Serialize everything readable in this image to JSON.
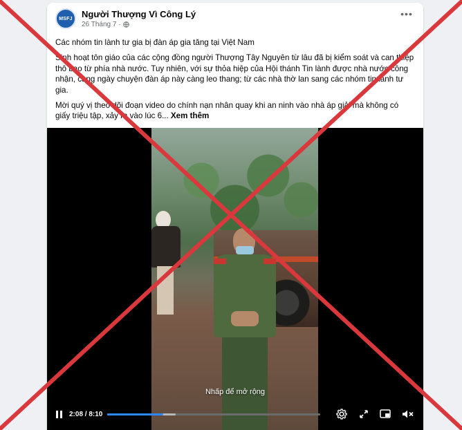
{
  "post": {
    "author": "Người Thượng Vì Công Lý",
    "avatar_text": "MSFJ",
    "date": "26 Tháng 7",
    "separator": "·",
    "title_line": "Các nhóm tin lành tư gia bị đàn áp gia tăng tại Việt Nam",
    "paragraph1": "Sinh hoạt tôn giáo của các cộng đồng người Thượng Tây Nguyên từ lâu đã bị kiểm soát và can thiệp thô bạo từ phía nhà nước. Tuy nhiên, với sự thỏa hiệp của Hội thánh Tin lành được nhà nước công nhận, càng ngày chuyện đàn áp này càng leo thang; từ các nhà thờ lan sang các nhóm tin lành tư gia.",
    "paragraph2": "Mời quý vị theo dõi đoạn video do chính nạn nhân quay  khi an ninh vào nhà áp giải mà không có giấy triệu tập, xảy ra vào lúc 6...",
    "see_more": "Xem thêm"
  },
  "video": {
    "expand_hint": "Nhấp để mở rộng",
    "time": "2:08 / 8:10",
    "progress": 0.262,
    "buffered": 0.32
  },
  "colors": {
    "accent": "#2d88ff",
    "cross": "#d9383c"
  },
  "icons": [
    "globe-icon",
    "more-icon",
    "pause-icon",
    "settings-icon",
    "fullscreen-icon",
    "pip-icon",
    "volume-muted-icon"
  ]
}
